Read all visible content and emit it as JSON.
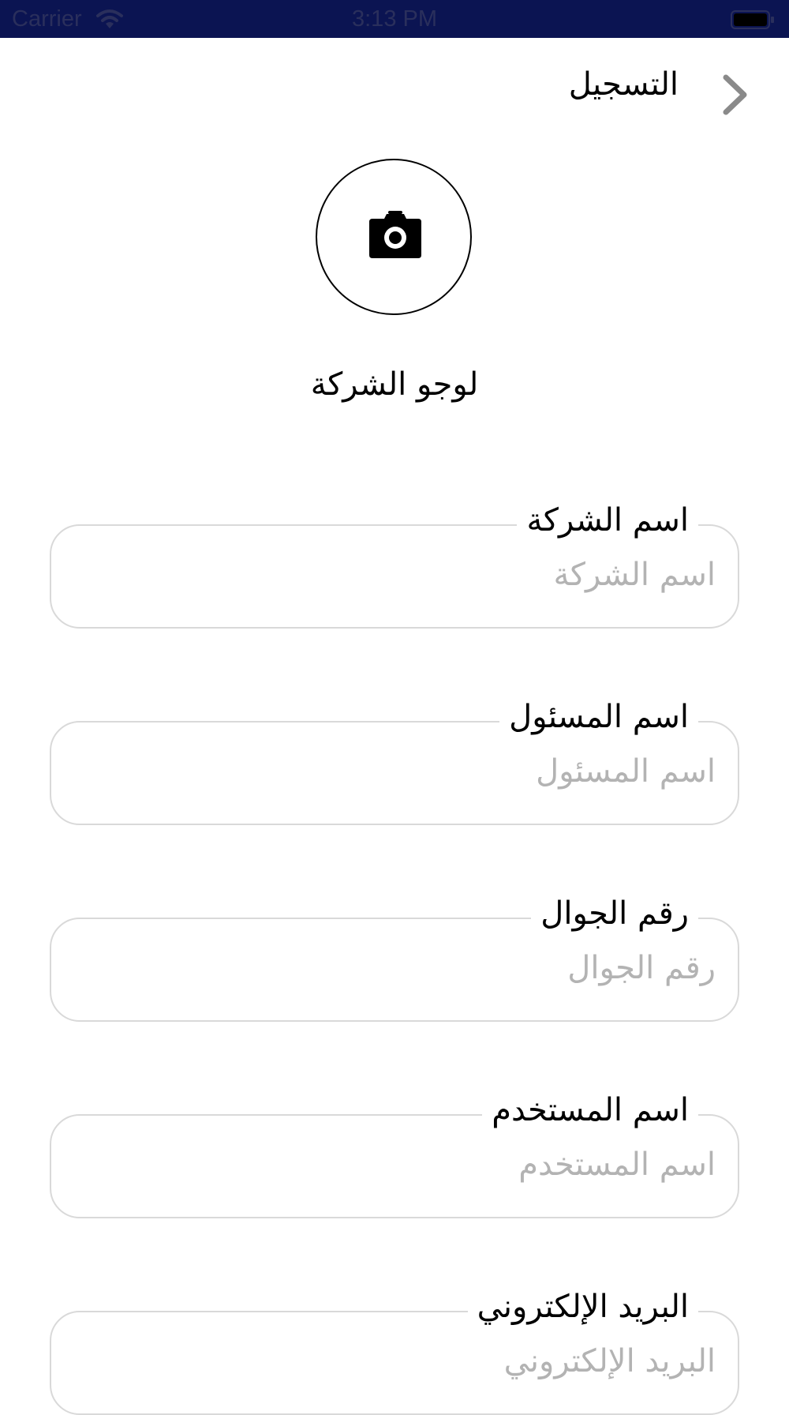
{
  "status_bar": {
    "carrier": "Carrier",
    "time": "3:13 PM",
    "wifi_icon": "wifi-icon",
    "battery_icon": "battery-icon"
  },
  "nav": {
    "title": "التسجيل",
    "back_icon": "chevron-right-icon"
  },
  "logo": {
    "label": "لوجو الشركة",
    "icon": "camera-icon"
  },
  "fields": [
    {
      "label": "اسم الشركة",
      "placeholder": "اسم الشركة",
      "value": ""
    },
    {
      "label": "اسم المسئول",
      "placeholder": "اسم المسئول",
      "value": ""
    },
    {
      "label": "رقم الجوال",
      "placeholder": "رقم الجوال",
      "value": ""
    },
    {
      "label": "اسم المستخدم",
      "placeholder": "اسم المستخدم",
      "value": ""
    },
    {
      "label": "البريد الإلكتروني",
      "placeholder": "البريد الإلكتروني",
      "value": ""
    }
  ],
  "colors": {
    "status_bar_bg": "#0b1452",
    "field_border": "#d9d9d9",
    "placeholder": "#b3b3b3",
    "chevron": "#8a8a8a"
  }
}
